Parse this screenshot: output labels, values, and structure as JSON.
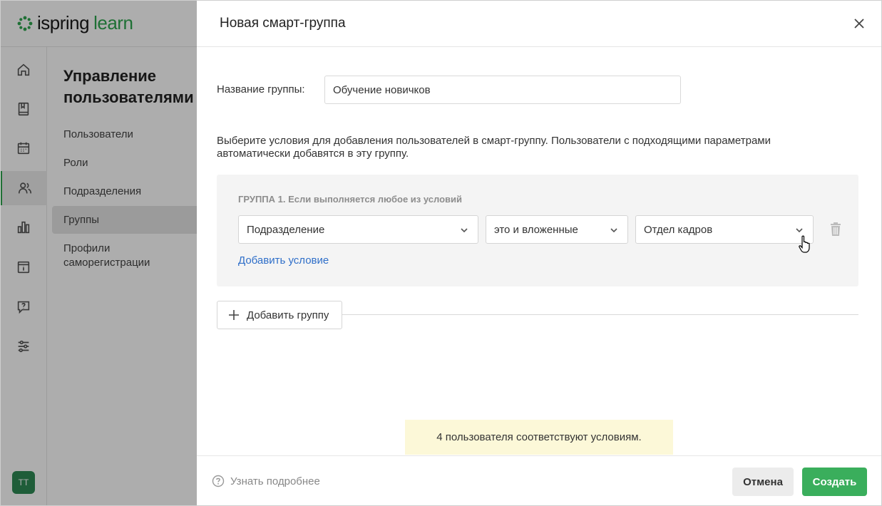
{
  "app": {
    "logo_a": "ispring",
    "logo_b": "learn",
    "rail_icons": [
      "home-icon",
      "book-icon",
      "calendar-icon",
      "users-icon",
      "bar-chart-icon",
      "info-icon",
      "help-icon",
      "settings-sliders-icon"
    ],
    "avatar_initials": "TT"
  },
  "subnav": {
    "title": "Управление пользователями",
    "items": [
      {
        "label": "Пользователи"
      },
      {
        "label": "Роли"
      },
      {
        "label": "Подразделения"
      },
      {
        "label": "Группы"
      },
      {
        "label": "Профили саморегистрации"
      }
    ],
    "active": "Группы"
  },
  "modal": {
    "title": "Новая смарт-группа",
    "name_label": "Название группы:",
    "name_value": "Обучение новичков",
    "description": "Выберите условия для добавления пользователей в смарт-группу. Пользователи с подходящими параметрами автоматически добавятся в эту группу.",
    "group": {
      "label": "ГРУППА 1. Если выполняется любое из условий",
      "condition": {
        "field": "Подразделение",
        "operator": "это и вложенные",
        "value": "Отдел кадров"
      },
      "add_condition": "Добавить условие"
    },
    "add_group": "Добавить группу",
    "notice": "4 пользователя соответствуют условиям.",
    "footer": {
      "learn_more": "Узнать подробнее",
      "cancel": "Отмена",
      "create": "Создать"
    }
  },
  "colors": {
    "accent_green": "#3aae5c",
    "link_blue": "#2f6fc9",
    "notice_bg": "#fcf8d8"
  }
}
